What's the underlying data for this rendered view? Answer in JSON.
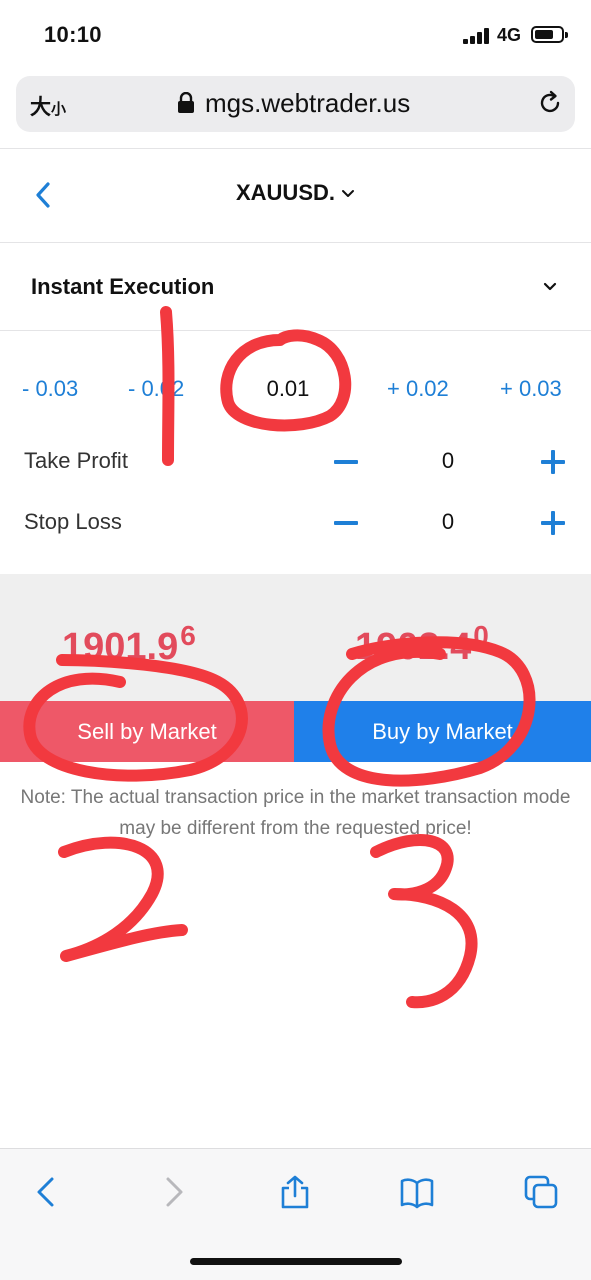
{
  "status_bar": {
    "time": "10:10",
    "network": "4G",
    "signal_icon": "signal-bars-icon",
    "battery_icon": "battery-icon",
    "battery_level": 0.7
  },
  "browser": {
    "text_size_label": "大",
    "text_size_label_small": "小",
    "url": "mgs.webtrader.us",
    "lock_icon": "lock-icon",
    "reload_icon": "reload-icon"
  },
  "header": {
    "back_icon": "chevron-left-icon",
    "symbol": "XAUUSD.",
    "symbol_dropdown_icon": "chevron-down-icon"
  },
  "order": {
    "execution_type": "Instant Execution",
    "execution_dropdown_icon": "chevron-down-icon",
    "volume_options": [
      "- 0.03",
      "- 0.02",
      "+ 0.02",
      "+ 0.03"
    ],
    "volume_value": "0.01",
    "take_profit": {
      "label": "Take Profit",
      "value": "0"
    },
    "stop_loss": {
      "label": "Stop Loss",
      "value": "0"
    }
  },
  "prices": {
    "sell_main": "1901.9",
    "sell_pip": "6",
    "buy_main": "1902.4",
    "buy_pip": "0",
    "sell_color": "#e24b5c",
    "buy_color": "#1f80ea"
  },
  "actions": {
    "sell_label": "Sell by Market",
    "buy_label": "Buy by Market"
  },
  "note": "Note: The actual transaction price in the market transaction mode may be different from the requested price!",
  "toolbar": {
    "icons": [
      "back-icon",
      "forward-icon",
      "share-icon",
      "bookmarks-icon",
      "tabs-icon"
    ]
  }
}
